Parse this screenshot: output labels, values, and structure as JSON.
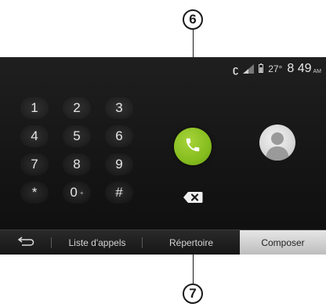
{
  "callouts": {
    "top": "6",
    "bottom": "7"
  },
  "status": {
    "temperature": "27°",
    "time": "8 49",
    "ampm": "AM"
  },
  "keypad": [
    {
      "label": "1",
      "sub": ""
    },
    {
      "label": "2",
      "sub": ""
    },
    {
      "label": "3",
      "sub": ""
    },
    {
      "label": "4",
      "sub": ""
    },
    {
      "label": "5",
      "sub": ""
    },
    {
      "label": "6",
      "sub": ""
    },
    {
      "label": "7",
      "sub": ""
    },
    {
      "label": "8",
      "sub": ""
    },
    {
      "label": "9",
      "sub": ""
    },
    {
      "label": "*",
      "sub": ""
    },
    {
      "label": "0",
      "sub": "+"
    },
    {
      "label": "#",
      "sub": ""
    }
  ],
  "tabs": {
    "back": "back-arrow-icon",
    "call_log": "Liste d'appels",
    "directory": "Répertoire",
    "dial": "Composer"
  },
  "colors": {
    "call_button": "#86bd1f",
    "active_tab": "#d6d6d6"
  },
  "icons": {
    "call": "phone-handset-icon",
    "delete": "backspace-icon",
    "contact": "contact-silhouette-icon"
  }
}
